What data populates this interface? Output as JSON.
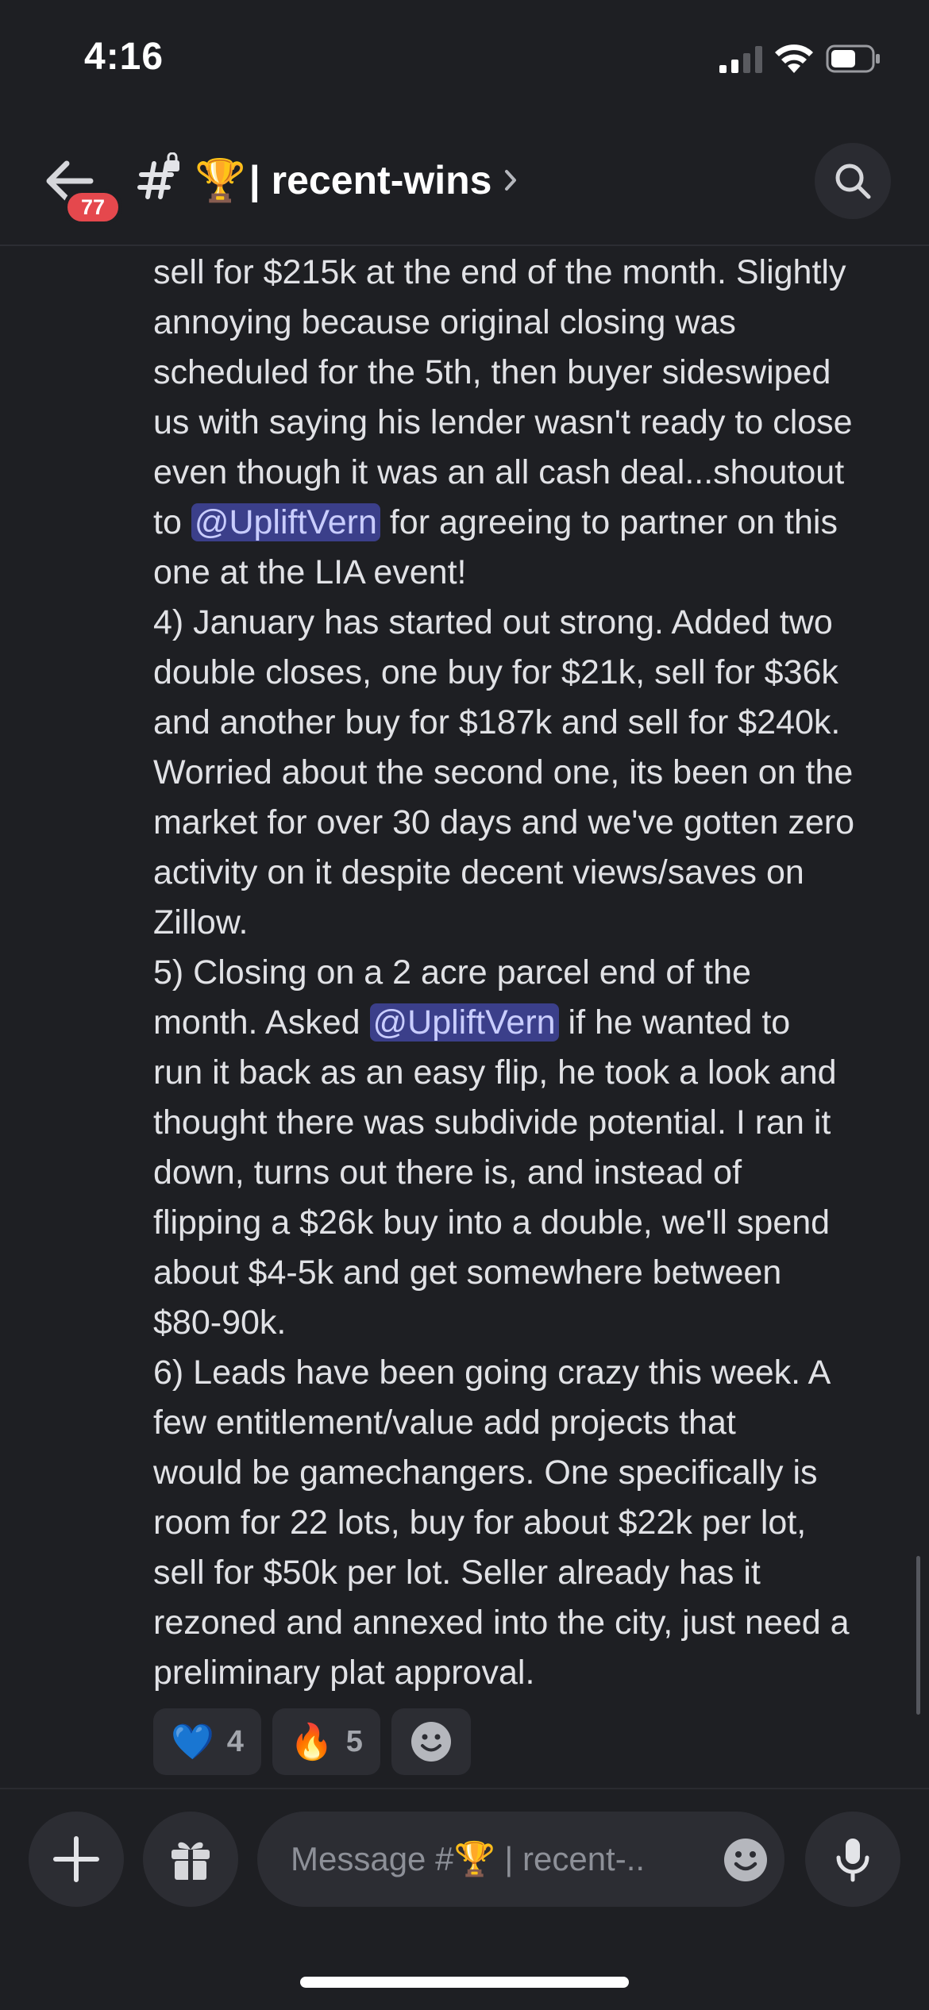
{
  "status_bar": {
    "time": "4:16"
  },
  "header": {
    "unread_count": "77",
    "channel_emoji": "🏆",
    "channel_name": "| recent-wins"
  },
  "message": {
    "lines": [
      {
        "segments": [
          {
            "text": "sell for $215k at the end of the month. Slightly"
          }
        ]
      },
      {
        "segments": [
          {
            "text": "annoying because original closing was"
          }
        ]
      },
      {
        "segments": [
          {
            "text": "scheduled for the 5th, then buyer sideswiped"
          }
        ]
      },
      {
        "segments": [
          {
            "text": "us with saying his lender wasn't ready to close"
          }
        ]
      },
      {
        "segments": [
          {
            "text": "even though it was an all cash deal...shoutout"
          }
        ]
      },
      {
        "segments": [
          {
            "text": "to "
          },
          {
            "text": "@UpliftVern",
            "mention": true
          },
          {
            "text": " for agreeing to partner on this"
          }
        ]
      },
      {
        "segments": [
          {
            "text": "one at the LIA event!"
          }
        ]
      },
      {
        "segments": [
          {
            "text": "4) January has started out strong. Added two"
          }
        ]
      },
      {
        "segments": [
          {
            "text": "double closes, one buy for $21k, sell for $36k"
          }
        ]
      },
      {
        "segments": [
          {
            "text": "and another buy for $187k and sell for $240k."
          }
        ]
      },
      {
        "segments": [
          {
            "text": "Worried about the second one, its been on the"
          }
        ]
      },
      {
        "segments": [
          {
            "text": "market for over 30 days and we've gotten zero"
          }
        ]
      },
      {
        "segments": [
          {
            "text": "activity on it despite decent views/saves on"
          }
        ]
      },
      {
        "segments": [
          {
            "text": "Zillow."
          }
        ]
      },
      {
        "segments": [
          {
            "text": "5) Closing on a 2 acre parcel end of the"
          }
        ]
      },
      {
        "segments": [
          {
            "text": "month. Asked "
          },
          {
            "text": "@UpliftVern",
            "mention": true
          },
          {
            "text": " if he wanted to"
          }
        ]
      },
      {
        "segments": [
          {
            "text": "run it back as an easy flip, he took a look and"
          }
        ]
      },
      {
        "segments": [
          {
            "text": "thought there was subdivide potential. I ran it"
          }
        ]
      },
      {
        "segments": [
          {
            "text": "down, turns out there is, and instead of"
          }
        ]
      },
      {
        "segments": [
          {
            "text": "flipping a $26k buy into a double, we'll spend"
          }
        ]
      },
      {
        "segments": [
          {
            "text": "about $4-5k and get somewhere between"
          }
        ]
      },
      {
        "segments": [
          {
            "text": "$80-90k."
          }
        ]
      },
      {
        "segments": [
          {
            "text": "6) Leads have been going crazy this week. A"
          }
        ]
      },
      {
        "segments": [
          {
            "text": "few entitlement/value add projects that"
          }
        ]
      },
      {
        "segments": [
          {
            "text": "would be gamechangers. One specifically is"
          }
        ]
      },
      {
        "segments": [
          {
            "text": "room for 22 lots, buy for about $22k per lot,"
          }
        ]
      },
      {
        "segments": [
          {
            "text": "sell for $50k per lot. Seller already has it"
          }
        ]
      },
      {
        "segments": [
          {
            "text": "rezoned and annexed into the city, just need a"
          }
        ]
      },
      {
        "segments": [
          {
            "text": "preliminary plat approval."
          }
        ]
      }
    ]
  },
  "reactions": [
    {
      "emoji": "💙",
      "count": "4",
      "icon": "blue-heart-icon"
    },
    {
      "emoji": "🔥",
      "count": "5",
      "icon": "fire-icon"
    }
  ],
  "composer": {
    "placeholder": "Message #🏆 | recent-.."
  },
  "colors": {
    "background": "#1e1f23",
    "badge": "#e5484d",
    "mention_bg": "#3b3f8a",
    "mention_text": "#c9cdff"
  }
}
